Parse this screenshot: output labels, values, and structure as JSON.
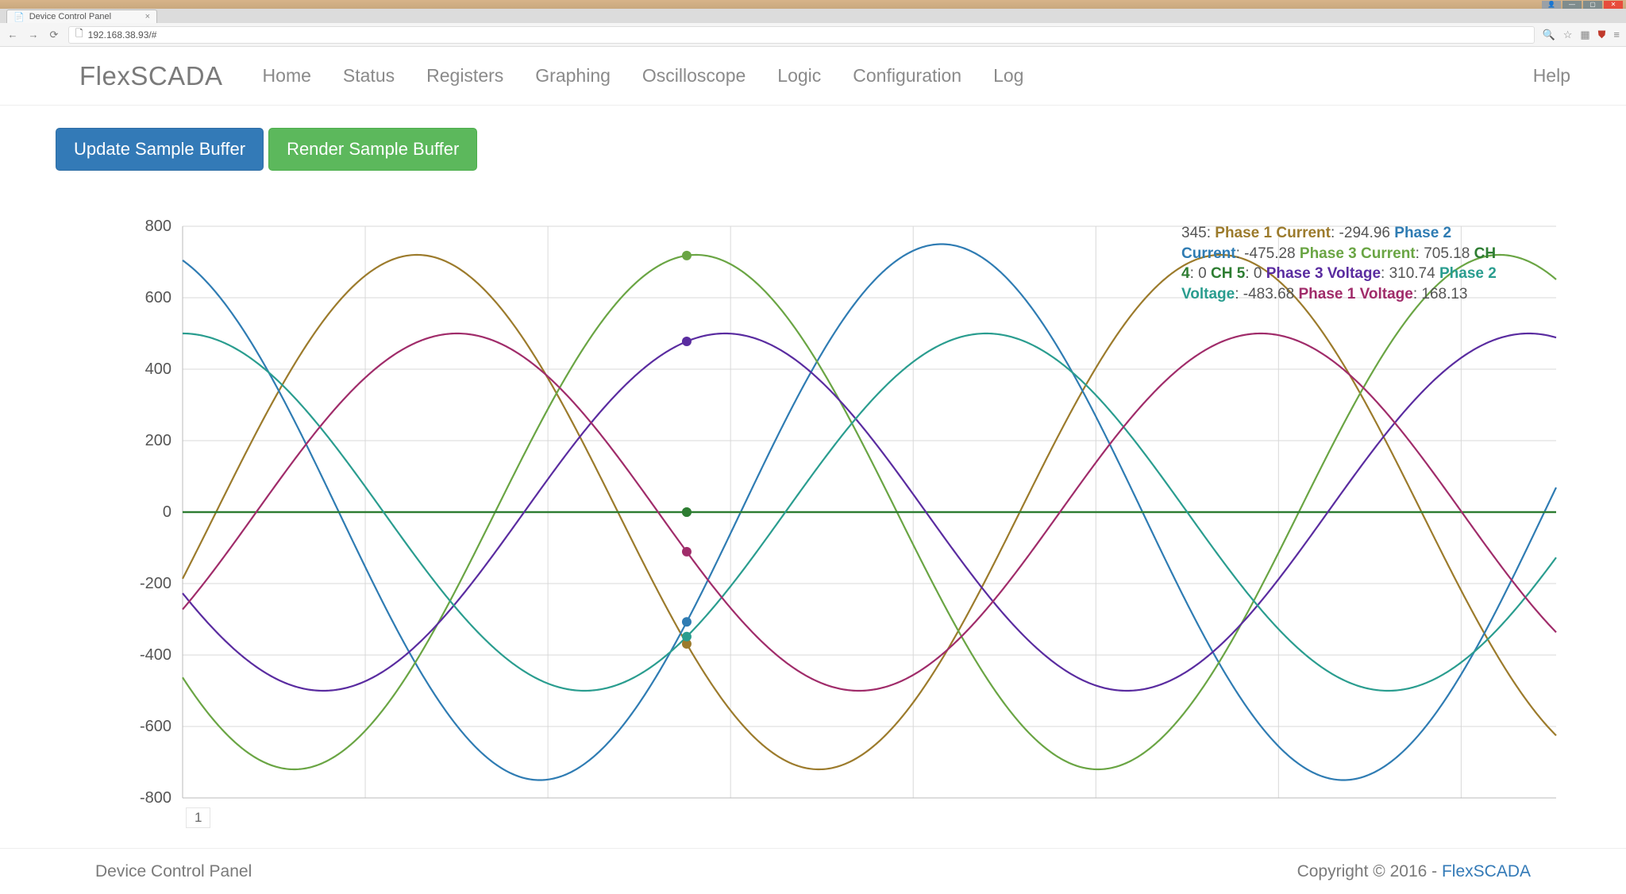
{
  "browser": {
    "tab_title": "Device Control Panel",
    "url": "192.168.38.93/#"
  },
  "navbar": {
    "brand": "FlexSCADA",
    "items": [
      "Home",
      "Status",
      "Registers",
      "Graphing",
      "Oscilloscope",
      "Logic",
      "Configuration",
      "Log"
    ],
    "right": "Help"
  },
  "buttons": {
    "update": "Update Sample Buffer",
    "render": "Render Sample Buffer"
  },
  "legend": {
    "cursor_x": "345",
    "items": [
      {
        "label": "Phase 1 Current",
        "value": "-294.96",
        "color": "#9c7b2c"
      },
      {
        "label": "Phase 2 Current",
        "value": "-475.28",
        "color": "#2f7cb3"
      },
      {
        "label": "Phase 3 Current",
        "value": "705.18",
        "color": "#6aa544"
      },
      {
        "label": "CH 4",
        "value": "0",
        "color": "#2e7d32"
      },
      {
        "label": "CH 5",
        "value": "0",
        "color": "#2e7d32"
      },
      {
        "label": "Phase 3 Voltage",
        "value": "310.74",
        "color": "#5a2ca0"
      },
      {
        "label": "Phase 2 Voltage",
        "value": "-483.68",
        "color": "#2a9d8f"
      },
      {
        "label": "Phase 1 Voltage",
        "value": "168.13",
        "color": "#a02c6a"
      }
    ]
  },
  "footer": {
    "left": "Device Control Panel",
    "right_prefix": "Copyright © 2016 - ",
    "right_link": "FlexSCADA"
  },
  "chart_data": {
    "type": "line",
    "xlabel": "",
    "ylabel": "",
    "ylim": [
      -800,
      800
    ],
    "xlim": [
      0,
      940
    ],
    "y_ticks": [
      -800,
      -600,
      -400,
      -200,
      0,
      200,
      400,
      600,
      800
    ],
    "x_ticks": [
      0,
      125,
      250,
      375,
      500,
      625,
      750,
      875
    ],
    "xlabel_box": "1",
    "cursor_x": 345,
    "series": [
      {
        "name": "Phase 1 Current",
        "color": "#9c7b2c",
        "amplitude": 720,
        "period": 550,
        "phase_deg": -15
      },
      {
        "name": "Phase 2 Current",
        "color": "#2f7cb3",
        "amplitude": 750,
        "period": 550,
        "phase_deg": 110
      },
      {
        "name": "Phase 3 Current",
        "color": "#6aa544",
        "amplitude": 720,
        "period": 550,
        "phase_deg": -140
      },
      {
        "name": "CH 4",
        "color": "#2e7d32",
        "amplitude": 0,
        "period": 550,
        "phase_deg": 0
      },
      {
        "name": "CH 5",
        "color": "#2e7d32",
        "amplitude": 0,
        "period": 550,
        "phase_deg": 0
      },
      {
        "name": "Phase 3 Voltage",
        "color": "#5a2ca0",
        "amplitude": 500,
        "period": 550,
        "phase_deg": 207
      },
      {
        "name": "Phase 2 Voltage",
        "color": "#2a9d8f",
        "amplitude": 500,
        "period": 550,
        "phase_deg": 90
      },
      {
        "name": "Phase 1 Voltage",
        "color": "#a02c6a",
        "amplitude": 500,
        "period": 550,
        "phase_deg": -33
      }
    ]
  }
}
